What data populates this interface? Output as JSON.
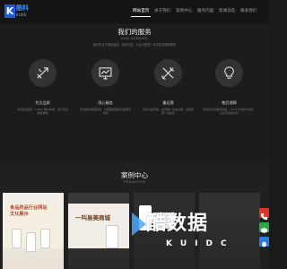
{
  "header": {
    "logo": {
      "mark": "K",
      "name": "酷科",
      "tagline": "KUKE"
    },
    "nav": [
      {
        "label": "网站首页",
        "active": true
      },
      {
        "label": "关于我们",
        "active": false
      },
      {
        "label": "案例中心",
        "active": false
      },
      {
        "label": "服务内容",
        "active": false
      },
      {
        "label": "新闻动态",
        "active": false
      },
      {
        "label": "联系我们",
        "active": false
      }
    ]
  },
  "services": {
    "title": "我们的服务",
    "subtitle": "OUR SERVICE",
    "description": "我们专注于网站建设，网站优化，为企业提供一站式的互联网服务",
    "items": [
      {
        "icon": "design-tools-icon",
        "title": "专注品质",
        "desc": "6年建站经验，1000+客户案例，设计专业精益求精"
      },
      {
        "icon": "chart-monitor-icon",
        "title": "用心服务",
        "desc": "专业团队精准高效，全程跟踪服务为您保驾护航"
      },
      {
        "icon": "wrench-tools-icon",
        "title": "重运营",
        "desc": "建站只是开始，运营推广才是关键，全网营销一站搞定"
      },
      {
        "icon": "lightbulb-icon",
        "title": "售后保障",
        "desc": "完善的售后服务体系，7x24小时技术支持，让您无后顾之忧"
      }
    ]
  },
  "cases": {
    "title": "案例中心",
    "subtitle": "PRODUCTS",
    "cards": [
      {
        "caption": "食品药品行业网站\n文化展示"
      },
      {
        "caption": "一叫易美商城"
      },
      {
        "caption": ""
      },
      {
        "caption": ""
      }
    ]
  },
  "watermark": {
    "text": "酷数据",
    "letters": "KUIDC"
  },
  "floating": [
    {
      "icon": "phone-icon",
      "color": "#e0302a"
    },
    {
      "icon": "chat-icon",
      "color": "#2ca84a"
    },
    {
      "icon": "qq-icon",
      "color": "#2a7de0"
    }
  ]
}
